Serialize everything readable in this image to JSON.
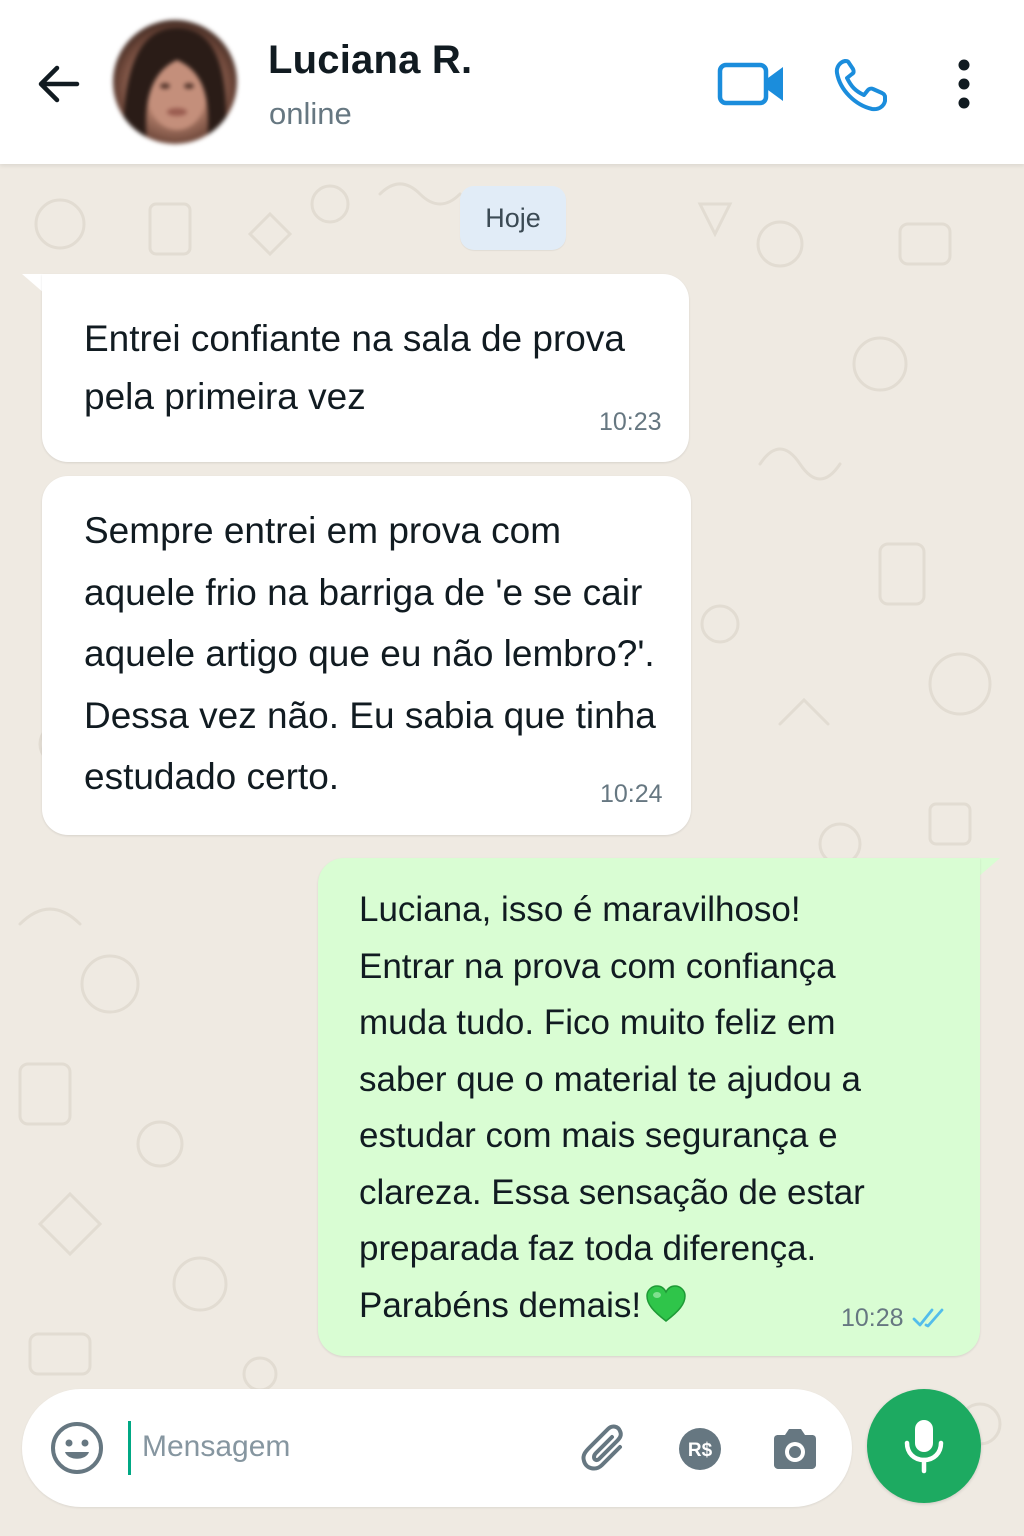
{
  "header": {
    "contact_name": "Luciana R.",
    "status": "online",
    "icons": [
      "back-arrow-icon",
      "video-call-icon",
      "phone-icon",
      "more-vertical-icon"
    ]
  },
  "chat": {
    "date_label": "Hoje",
    "messages": [
      {
        "direction": "incoming",
        "text": "Entrei confiante na sala de prova\npela primeira vez",
        "time": "10:23"
      },
      {
        "direction": "incoming",
        "text": "Sempre entrei em prova com\naquele frio na barriga de 'e se cair\naquele artigo que eu não lembro?'.\nDessa vez não. Eu sabia que tinha\nestudado certo.",
        "time": "10:24"
      },
      {
        "direction": "outgoing",
        "text": "Luciana, isso é maravilhoso!\nEntrar na prova com confiança\nmuda tudo. Fico muito feliz em\nsaber que o material te ajudou a\nestudar com mais segurança e\nclareza. Essa sensação de estar\npreparada faz toda diferença.\nParabéns demais!",
        "emoji": "green-heart-icon",
        "time": "10:28",
        "status": "read"
      }
    ]
  },
  "composer": {
    "placeholder": "Mensagem",
    "icons": [
      "emoji-icon",
      "paperclip-icon",
      "payment-icon",
      "camera-icon",
      "microphone-icon"
    ],
    "payment_label": "R$"
  },
  "colors": {
    "accent": "#1daa61",
    "outgoing_bubble": "#d9fdd3",
    "incoming_bubble": "#ffffff",
    "chat_background": "#efeae2",
    "icon_blue": "#1b8ddc",
    "read_ticks": "#53bdeb"
  }
}
